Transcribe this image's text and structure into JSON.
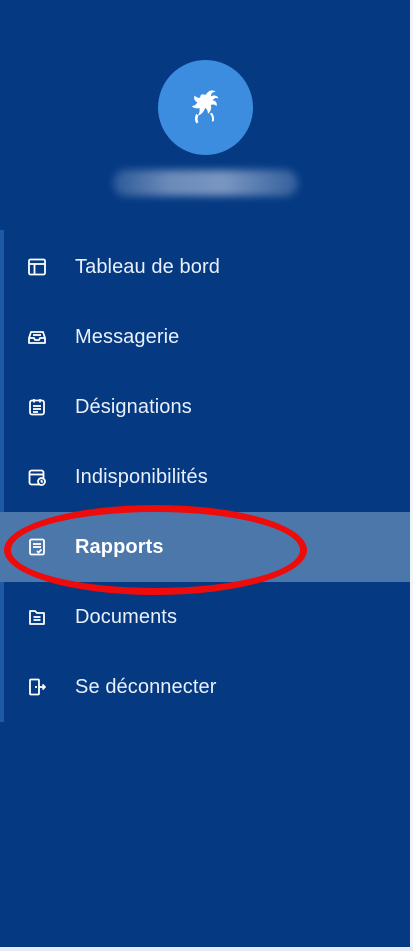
{
  "brand": {
    "logo_icon": "rooster-logo-icon",
    "avatar_color": "#3c8de0",
    "sidebar_color": "#053a83",
    "active_color": "#4c77aa",
    "highlight_color": "#ee0b0b"
  },
  "menu": {
    "items": [
      {
        "label": "Tableau de bord",
        "icon": "dashboard-icon",
        "active": false
      },
      {
        "label": "Messagerie",
        "icon": "inbox-icon",
        "active": false
      },
      {
        "label": "Désignations",
        "icon": "calendar-list-icon",
        "active": false
      },
      {
        "label": "Indisponibilités",
        "icon": "calendar-clock-icon",
        "active": false
      },
      {
        "label": "Rapports",
        "icon": "report-icon",
        "active": true
      },
      {
        "label": "Documents",
        "icon": "documents-icon",
        "active": false
      },
      {
        "label": "Se déconnecter",
        "icon": "logout-icon",
        "active": false
      }
    ]
  }
}
